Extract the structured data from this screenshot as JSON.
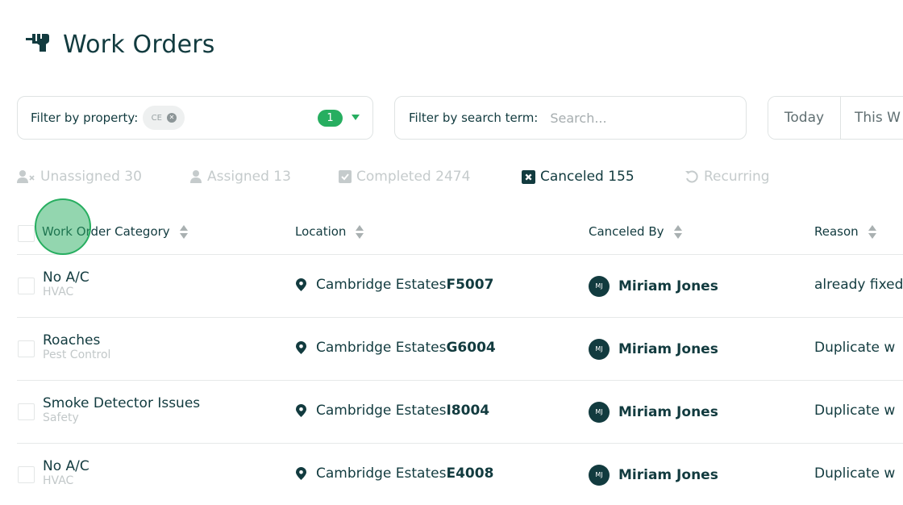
{
  "header": {
    "title": "Work Orders",
    "icon": "drill-icon"
  },
  "filters": {
    "property_label": "Filter by property:",
    "property_chip": "CE",
    "property_count": "1",
    "search_label": "Filter by search term:",
    "search_placeholder": "Search...",
    "search_value": ""
  },
  "date_range": {
    "buttons": [
      "Today",
      "This W"
    ]
  },
  "tabs": [
    {
      "label": "Unassigned 30",
      "icon": "user-x-icon",
      "active": false
    },
    {
      "label": "Assigned 13",
      "icon": "user-icon",
      "active": false
    },
    {
      "label": "Completed 2474",
      "icon": "check-square-icon",
      "active": false
    },
    {
      "label": "Canceled 155",
      "icon": "x-square-icon",
      "active": true
    },
    {
      "label": "Recurring",
      "icon": "recurring-icon",
      "active": false
    }
  ],
  "table": {
    "columns": [
      "Work Order Category",
      "Location",
      "Canceled By",
      "Reason"
    ],
    "rows": [
      {
        "category": "No A/C",
        "subcategory": "HVAC",
        "property": "Cambridge Estates",
        "unit": "F5007",
        "initials": "MJ",
        "canceled_by": "Miriam Jones",
        "reason": "already fixed"
      },
      {
        "category": "Roaches",
        "subcategory": "Pest Control",
        "property": "Cambridge Estates",
        "unit": "G6004",
        "initials": "MJ",
        "canceled_by": "Miriam Jones",
        "reason": "Duplicate w"
      },
      {
        "category": "Smoke Detector Issues",
        "subcategory": "Safety",
        "property": "Cambridge Estates",
        "unit": "I8004",
        "initials": "MJ",
        "canceled_by": "Miriam Jones",
        "reason": "Duplicate w"
      },
      {
        "category": "No A/C",
        "subcategory": "HVAC",
        "property": "Cambridge Estates",
        "unit": "E4008",
        "initials": "MJ",
        "canceled_by": "Miriam Jones",
        "reason": "Duplicate w"
      }
    ]
  },
  "colors": {
    "primary": "#123b3f",
    "accent_green": "#27ae60",
    "muted": "#c5cbcc"
  }
}
